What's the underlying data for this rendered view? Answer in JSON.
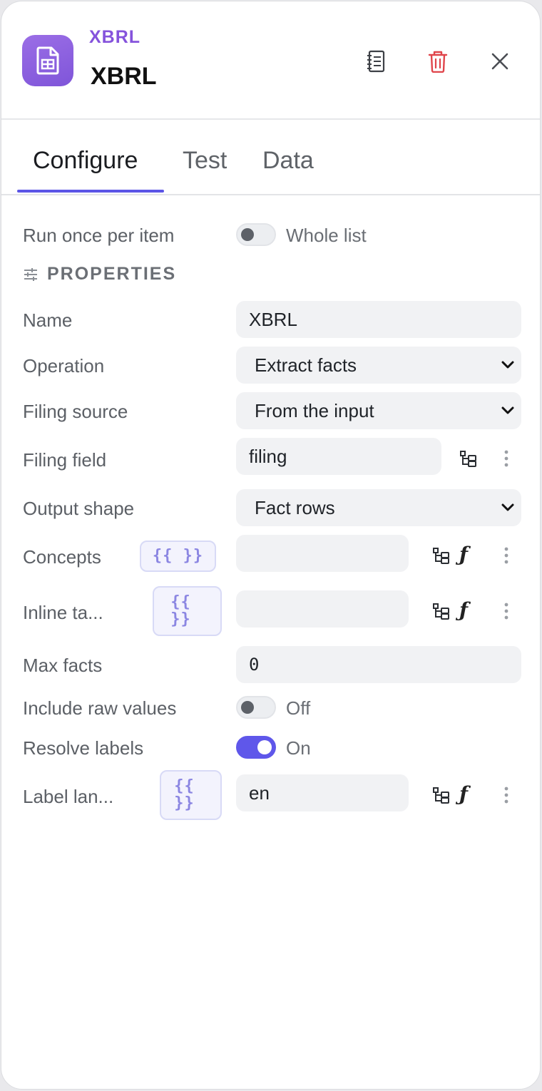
{
  "header": {
    "node_type": "XBRL",
    "title": "XBRL",
    "icons": {
      "app": "document-table-icon",
      "notes": "notebook-icon",
      "delete": "trash-icon",
      "close": "close-icon"
    },
    "delete_color": "#e0454b",
    "accent_color": "#8553dc"
  },
  "tabs": [
    {
      "label": "Configure",
      "active": true
    },
    {
      "label": "Test",
      "active": false
    },
    {
      "label": "Data",
      "active": false
    }
  ],
  "run_mode": {
    "label": "Run once per item",
    "toggle_text": "Whole list",
    "enabled": false
  },
  "properties": {
    "section_title": "PROPERTIES",
    "name": {
      "label": "Name",
      "value": "XBRL"
    },
    "operation": {
      "label": "Operation",
      "value": "Extract facts"
    },
    "filing_source": {
      "label": "Filing source",
      "value": "From the input"
    },
    "filing_field": {
      "label": "Filing field",
      "value": "filing"
    },
    "output_shape": {
      "label": "Output shape",
      "value": "Fact rows"
    },
    "concepts": {
      "label": "Concepts",
      "expr_label": "{{ }}",
      "value": ""
    },
    "inline_tags": {
      "label": "Inline ta...",
      "expr_label": "{{ }}",
      "value": ""
    },
    "max_facts": {
      "label": "Max facts",
      "value": "0"
    },
    "include_raw_values": {
      "label": "Include raw values",
      "toggle_text": "Off",
      "enabled": false
    },
    "resolve_labels": {
      "label": "Resolve labels",
      "toggle_text": "On",
      "enabled": true
    },
    "label_language": {
      "label": "Label lan...",
      "expr_label": "{{ }}",
      "value": "en"
    }
  },
  "toggle_on_color": "#5f57ea"
}
